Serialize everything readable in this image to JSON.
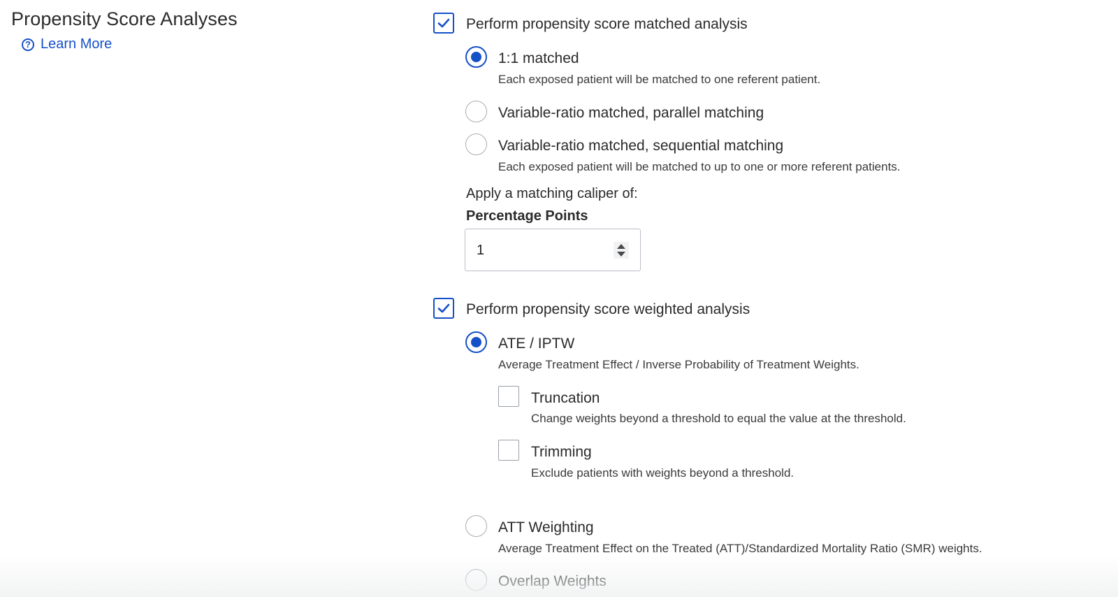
{
  "section": {
    "title": "Propensity Score Analyses",
    "learn_more": "Learn More"
  },
  "matched": {
    "checkbox_label": "Perform propensity score matched analysis",
    "checked": true,
    "options": [
      {
        "label": "1:1 matched",
        "description": "Each exposed patient will be matched to one referent patient.",
        "selected": true
      },
      {
        "label": "Variable-ratio matched, parallel matching",
        "description": "",
        "selected": false
      },
      {
        "label": "Variable-ratio matched, sequential matching",
        "description": "Each exposed patient will be matched to up to one or more referent patients.",
        "selected": false
      }
    ],
    "caliper_label": "Apply a matching caliper of:",
    "caliper_unit_label": "Percentage Points",
    "caliper_value": "1"
  },
  "weighted": {
    "checkbox_label": "Perform propensity score weighted analysis",
    "checked": true,
    "options": [
      {
        "label": "ATE / IPTW",
        "description": "Average Treatment Effect / Inverse Probability of Treatment Weights.",
        "selected": true
      },
      {
        "label": "ATT Weighting",
        "description": "Average Treatment Effect on the Treated (ATT)/Standardized Mortality Ratio (SMR) weights.",
        "selected": false
      },
      {
        "label": "Overlap Weights",
        "description": "",
        "selected": false
      }
    ],
    "sub_options": [
      {
        "label": "Truncation",
        "description": "Change weights beyond a threshold to equal the value at the threshold.",
        "checked": false
      },
      {
        "label": "Trimming",
        "description": "Exclude patients with weights beyond a threshold.",
        "checked": false
      }
    ]
  },
  "colors": {
    "accent": "#1550c8",
    "border": "#a7adb3"
  },
  "icons": {
    "help": "help-circle-icon",
    "check": "check-icon"
  }
}
